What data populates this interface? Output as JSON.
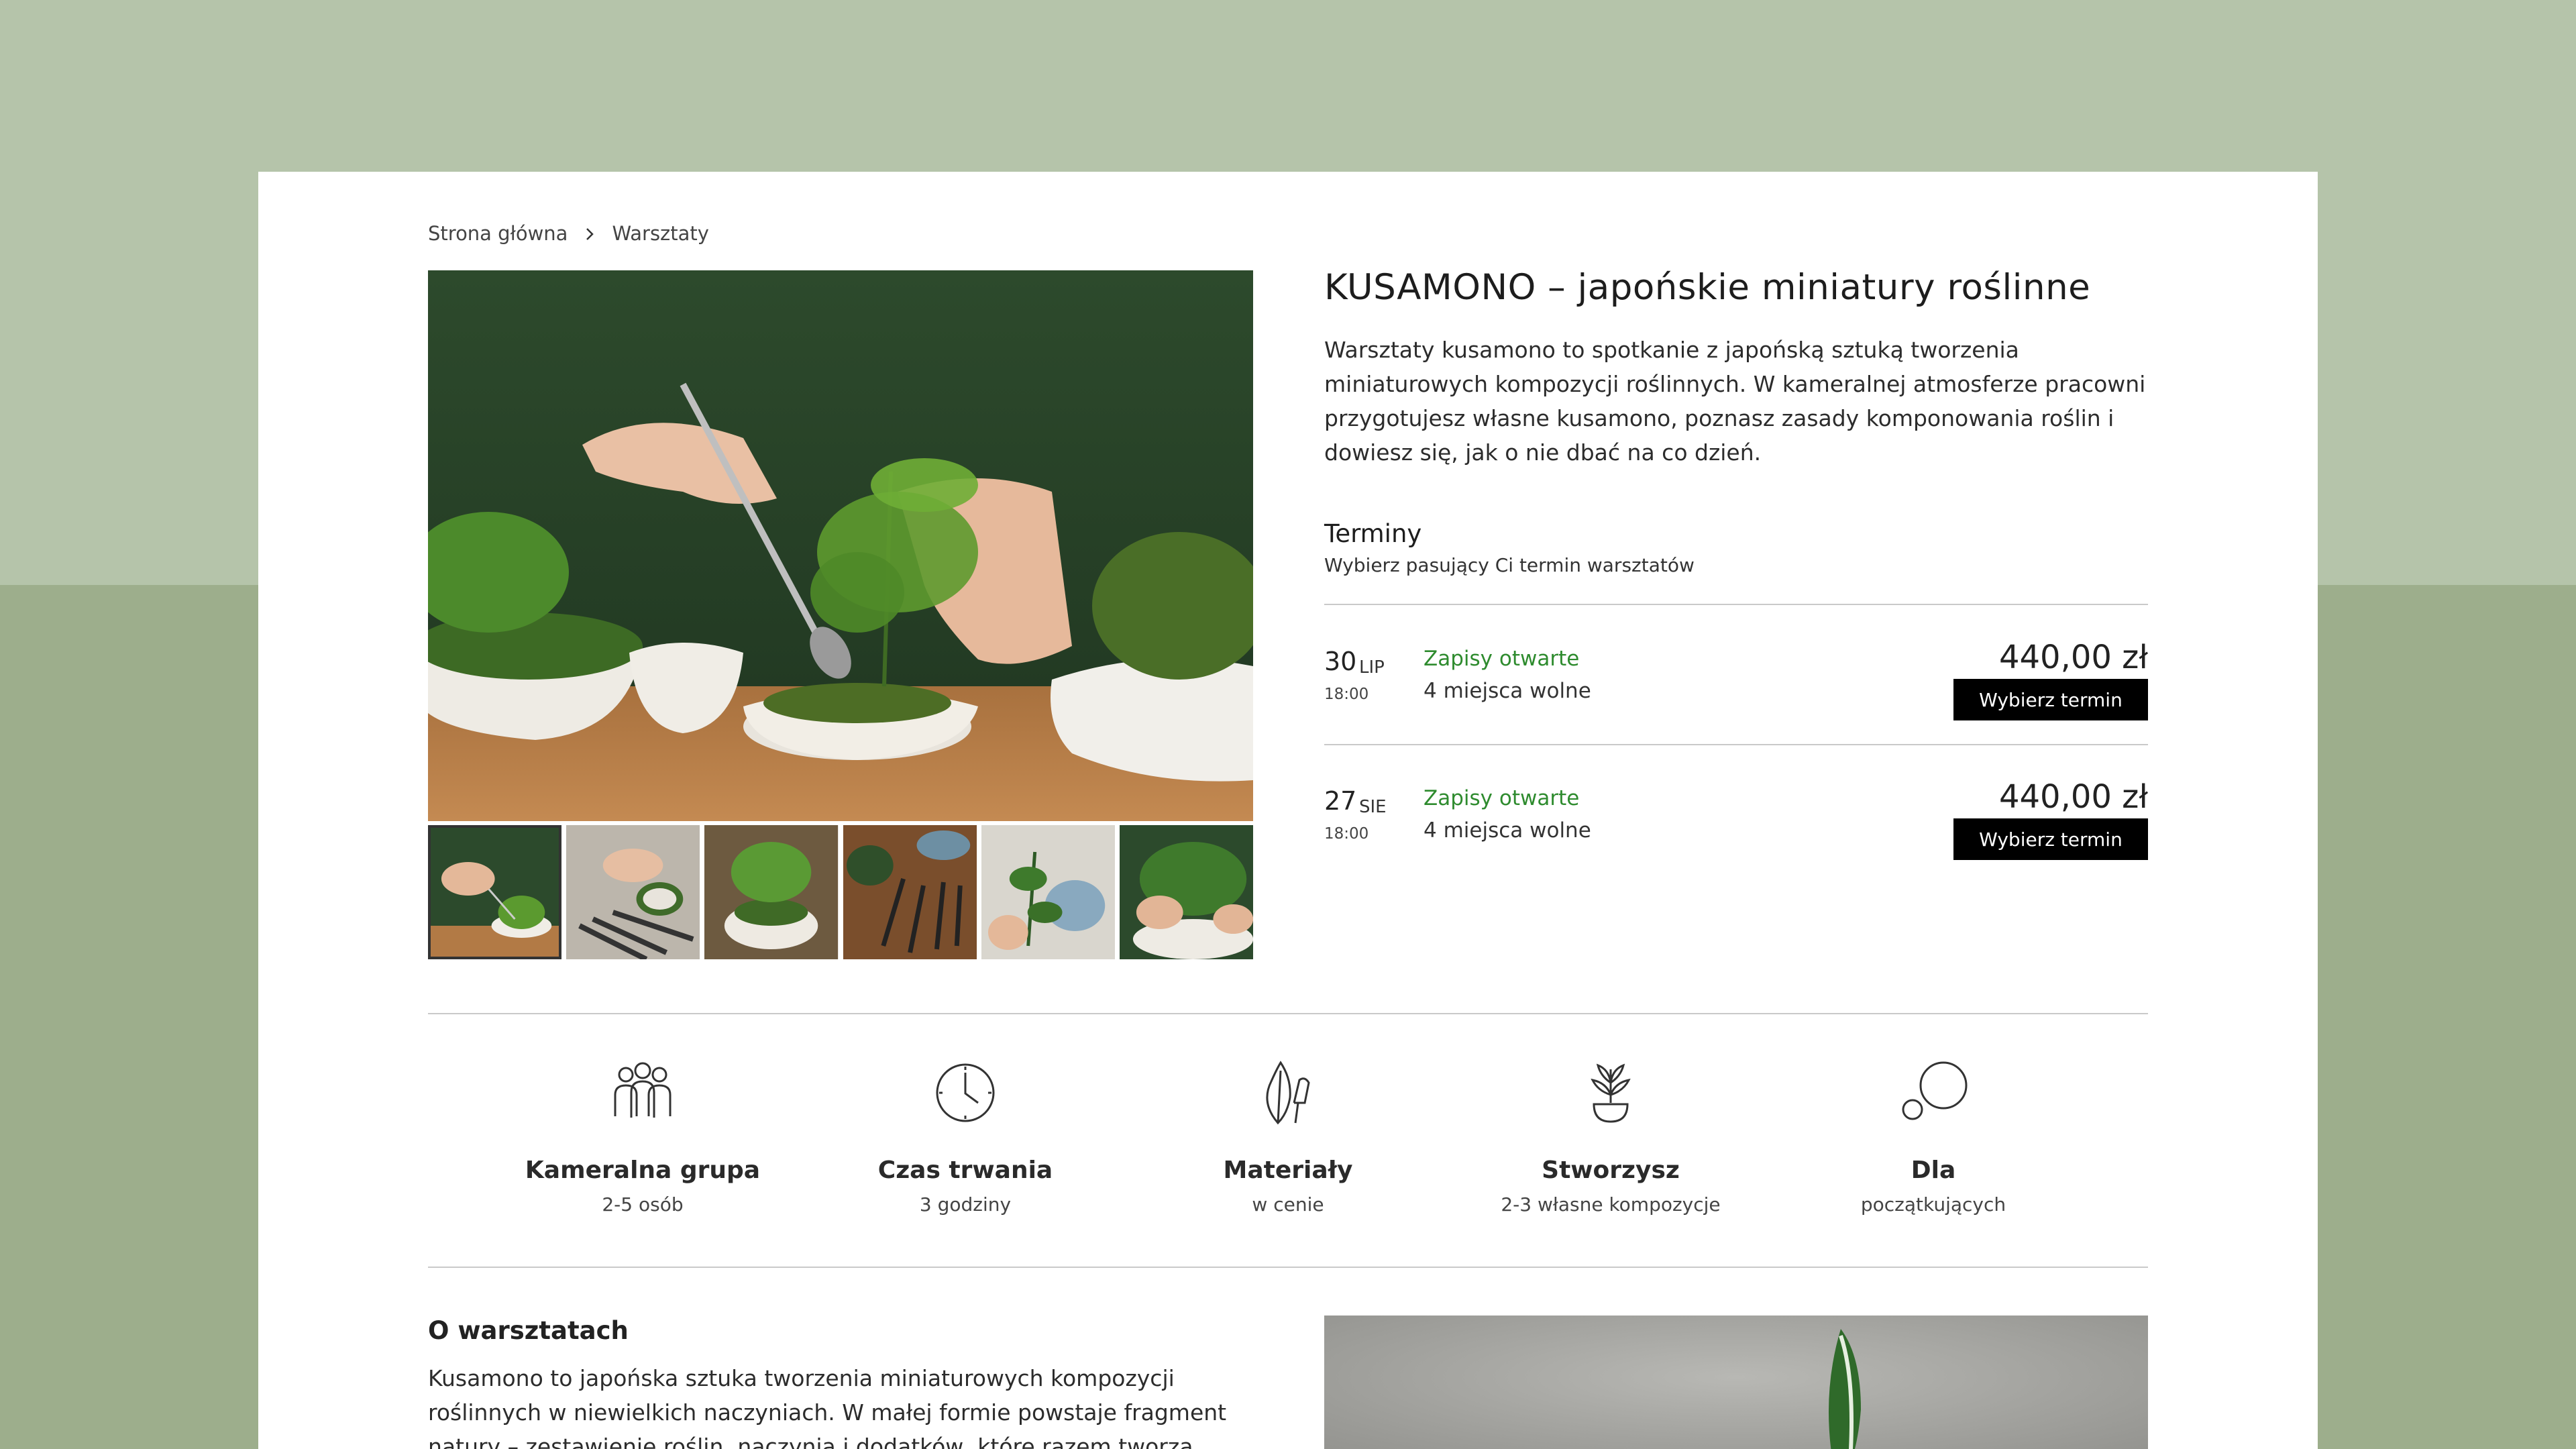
{
  "breadcrumb": {
    "home": "Strona główna",
    "current": "Warsztaty"
  },
  "product": {
    "title": "KUSAMONO – japońskie miniatury roślinne",
    "description": "Warsztaty kusamono to spotkanie z japońską sztuką tworzenia miniaturowych kompozycji roślinnych. W kameralnej atmosferze pracowni przygotujesz własne kusamono, poznasz zasady komponowania roślin i dowiesz się, jak o nie dbać na co dzień."
  },
  "terms": {
    "heading": "Terminy",
    "subheading": "Wybierz pasujący Ci termin warsztatów",
    "items": [
      {
        "day": "30",
        "month": "LIP",
        "time": "18:00",
        "status": "Zapisy otwarte",
        "seats": "4 miejsca wolne",
        "price": "440,00 zł",
        "button": "Wybierz termin"
      },
      {
        "day": "27",
        "month": "SIE",
        "time": "18:00",
        "status": "Zapisy otwarte",
        "seats": "4 miejsca wolne",
        "price": "440,00 zł",
        "button": "Wybierz termin"
      }
    ]
  },
  "features": [
    {
      "icon": "people-icon",
      "title": "Kameralna grupa",
      "subtitle": "2-5 osób"
    },
    {
      "icon": "clock-icon",
      "title": "Czas trwania",
      "subtitle": "3 godziny"
    },
    {
      "icon": "leaf-trowel-icon",
      "title": "Materiały",
      "subtitle": "w cenie"
    },
    {
      "icon": "potted-plant-icon",
      "title": "Stworzysz",
      "subtitle": "2-3 własne kompozycje"
    },
    {
      "icon": "circles-icon",
      "title": "Dla",
      "subtitle": "początkujących"
    }
  ],
  "about": {
    "heading": "O warsztatach",
    "text": "Kusamono to japońska sztuka tworzenia miniaturowych kompozycji roślinnych w niewielkich naczyniach. W małej formie powstaje fragment natury – zestawienie roślin, naczynia i dodatków, które razem tworzą"
  },
  "colors": {
    "status_green": "#2e8b2e",
    "button_black": "#000000",
    "bg_sage": "#b5c4aa"
  }
}
